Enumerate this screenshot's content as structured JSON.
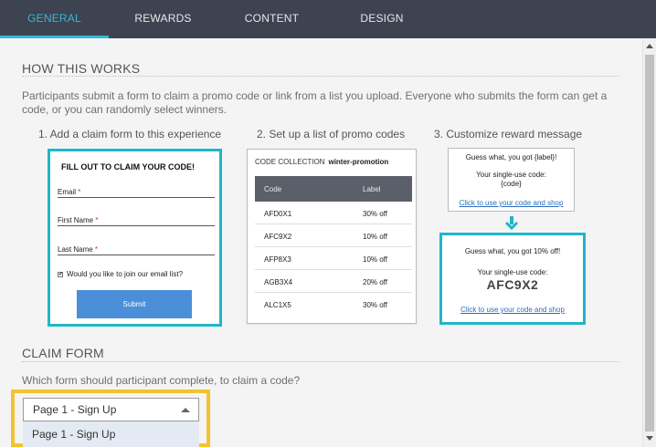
{
  "tabs": [
    {
      "label": "GENERAL",
      "active": true
    },
    {
      "label": "REWARDS",
      "active": false
    },
    {
      "label": "CONTENT",
      "active": false
    },
    {
      "label": "DESIGN",
      "active": false
    }
  ],
  "how": {
    "title": "HOW THIS WORKS",
    "description": "Participants submit a form to claim a promo code or link from a list you upload. Everyone who submits the form can get a code, or you can randomly select winners.",
    "steps": [
      "1. Add a claim form to this experience",
      "2. Set up a list of promo codes",
      "3. Customize reward message"
    ]
  },
  "form_preview": {
    "title": "FILL OUT TO CLAIM YOUR CODE!",
    "fields": [
      "Email",
      "First Name",
      "Last Name"
    ],
    "required_mark": "*",
    "checkbox_mark": "✔",
    "checkbox_label": "Would you like to join our email list?",
    "submit_label": "Submit"
  },
  "code_collection": {
    "heading": "CODE COLLECTION",
    "name": "winter-promotion",
    "columns": [
      "Code",
      "Label"
    ],
    "rows": [
      [
        "AFD0X1",
        "30% off"
      ],
      [
        "AFC9X2",
        "10% off"
      ],
      [
        "AFP8X3",
        "10% off"
      ],
      [
        "AGB3X4",
        "20% off"
      ],
      [
        "ALC1X5",
        "30% off"
      ]
    ]
  },
  "reward_template": {
    "line1": "Guess what, you got {label}!",
    "line2": "Your single-use code:",
    "line3": "{code}",
    "link": "Click to use your code and shop"
  },
  "reward_result": {
    "line1": "Guess what, you got 10% off!",
    "line2": "Your single-use code:",
    "code": "AFC9X2",
    "link": "Click to use your code and shop"
  },
  "claim": {
    "title": "CLAIM FORM",
    "question": "Which form should participant complete, to claim a code?",
    "selected": "Page 1 - Sign Up",
    "options": [
      "Page 1 - Sign Up"
    ]
  },
  "colors": {
    "tab_bar": "#3d4350",
    "accent": "#33b8d8",
    "highlight_teal": "#20b6c9",
    "highlight_yellow": "#f2c230",
    "submit_button": "#4a8fd8"
  }
}
